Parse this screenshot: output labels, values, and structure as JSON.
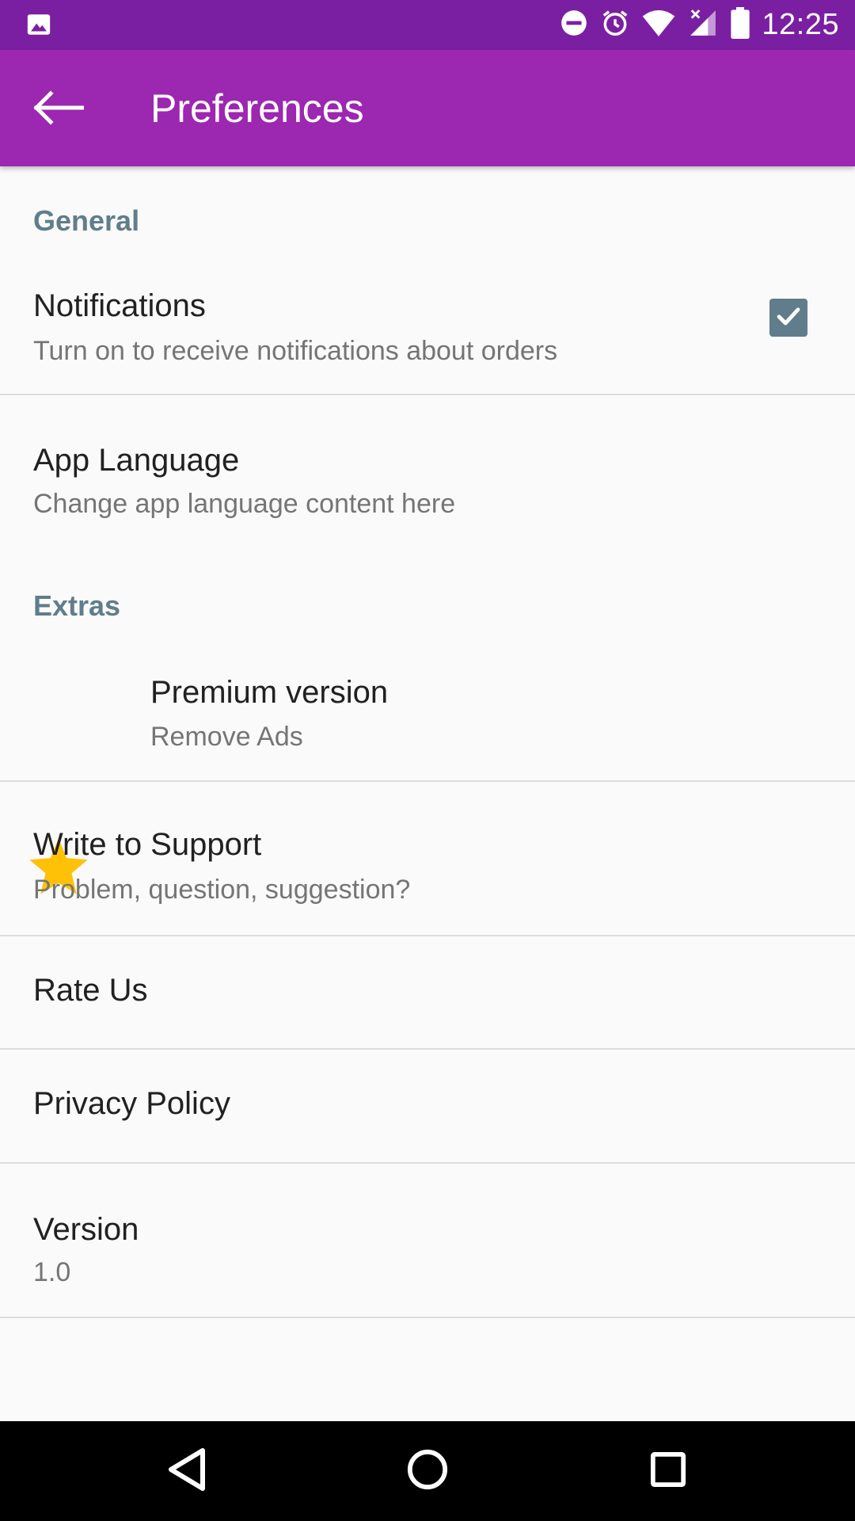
{
  "status_bar": {
    "time": "12:25",
    "icons": [
      "image-icon",
      "do-not-disturb-icon",
      "alarm-icon",
      "wifi-icon",
      "signal-icon",
      "battery-icon"
    ]
  },
  "app_bar": {
    "title": "Preferences",
    "back_icon": "arrow-back-icon"
  },
  "sections": {
    "general": "General",
    "extras": "Extras"
  },
  "prefs": {
    "notifications": {
      "title": "Notifications",
      "summary": "Turn on to receive notifications about orders",
      "checked": true
    },
    "language": {
      "title": "App Language",
      "summary": "Change app language content here"
    },
    "premium": {
      "title": "Premium version",
      "summary": "Remove Ads",
      "icon": "star-icon"
    },
    "support": {
      "title": "Write to Support",
      "summary": "Problem, question, suggestion?"
    },
    "rate": {
      "title": "Rate Us"
    },
    "privacy": {
      "title": "Privacy Policy"
    },
    "version": {
      "title": "Version",
      "summary": "1.0"
    }
  },
  "nav_bar": {
    "icons": [
      "back-triangle-icon",
      "home-circle-icon",
      "recents-square-icon"
    ]
  },
  "colors": {
    "status_bar": "#7B1FA2",
    "app_bar": "#9C27B0",
    "section_header": "#607D8B",
    "checkbox": "#607D8B",
    "star": "#FFC107",
    "background": "#FAFAFA"
  }
}
